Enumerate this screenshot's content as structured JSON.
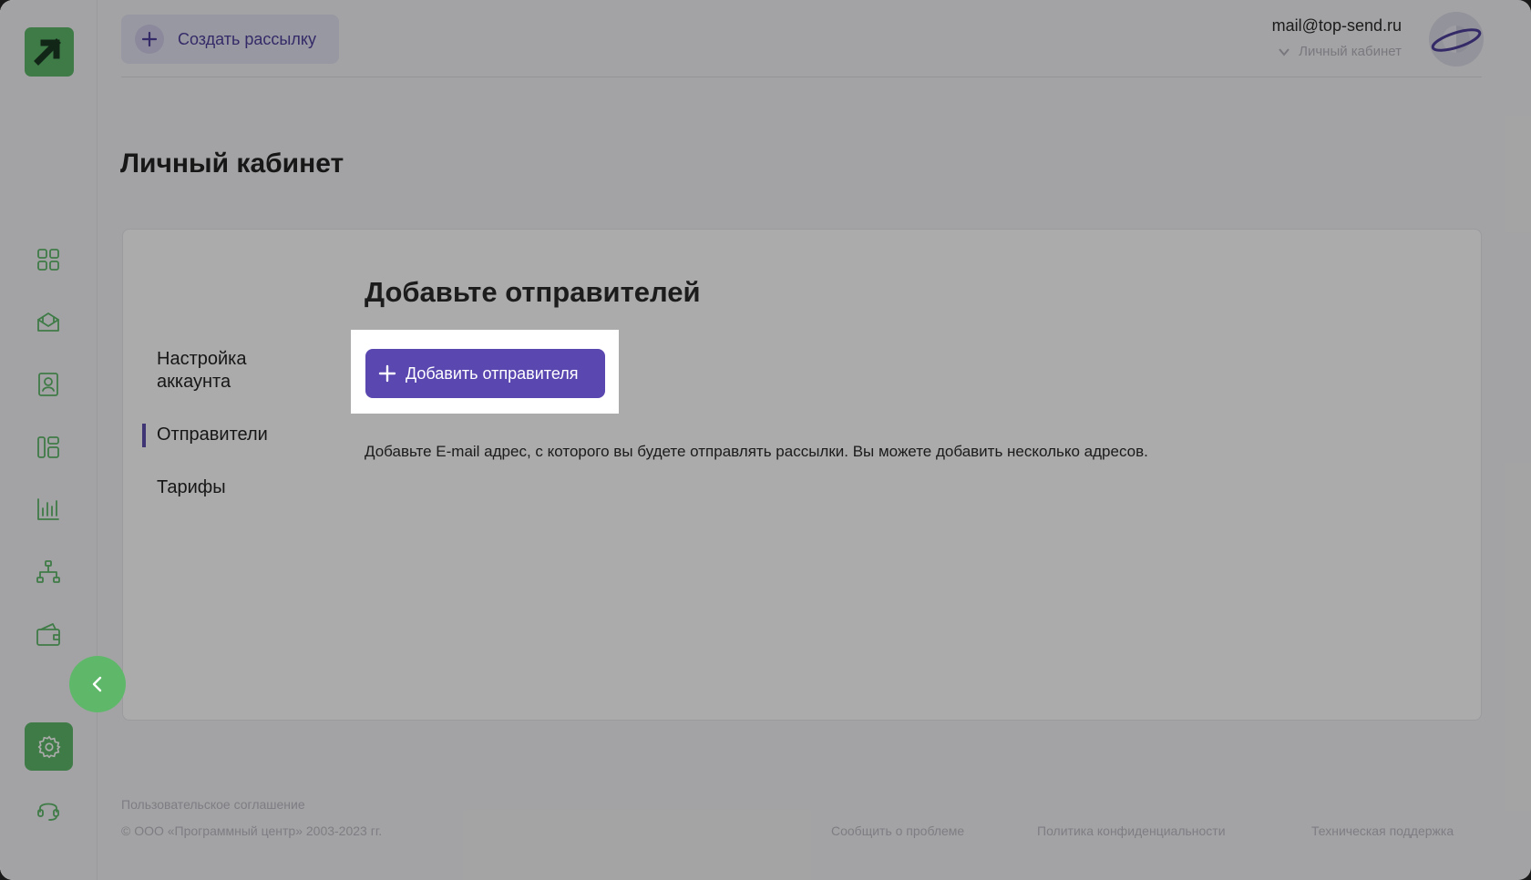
{
  "header": {
    "create_button_label": "Создать рассылку",
    "user_email": "mail@top-send.ru",
    "user_menu_label": "Личный кабинет"
  },
  "page": {
    "title": "Личный кабинет"
  },
  "tabs": [
    {
      "label": "Настройка аккаунта",
      "active": false
    },
    {
      "label": "Отправители",
      "active": true
    },
    {
      "label": "Тарифы",
      "active": false
    }
  ],
  "senders": {
    "title": "Добавьте отправителей",
    "add_button_label": "Добавить отправителя",
    "description": "Добавьте E-mail адрес, с которого вы будете отправлять рассылки. Вы можете добавить несколько адресов."
  },
  "footer": {
    "agreement": "Пользовательское соглашение",
    "copyright": "© ООО «Программный центр» 2003-2023 гг.",
    "report_problem": "Сообщить о проблеме",
    "privacy_policy": "Политика конфиденциальности",
    "support": "Техническая поддержка"
  },
  "sidebar": {
    "icons": [
      "dashboard-icon",
      "campaigns-icon",
      "contacts-icon",
      "templates-icon",
      "stats-icon",
      "automation-icon",
      "wallet-icon",
      "settings-icon",
      "support-icon"
    ]
  },
  "colors": {
    "brand_green": "#5fb86a",
    "accent_purple": "#5a47b0"
  }
}
